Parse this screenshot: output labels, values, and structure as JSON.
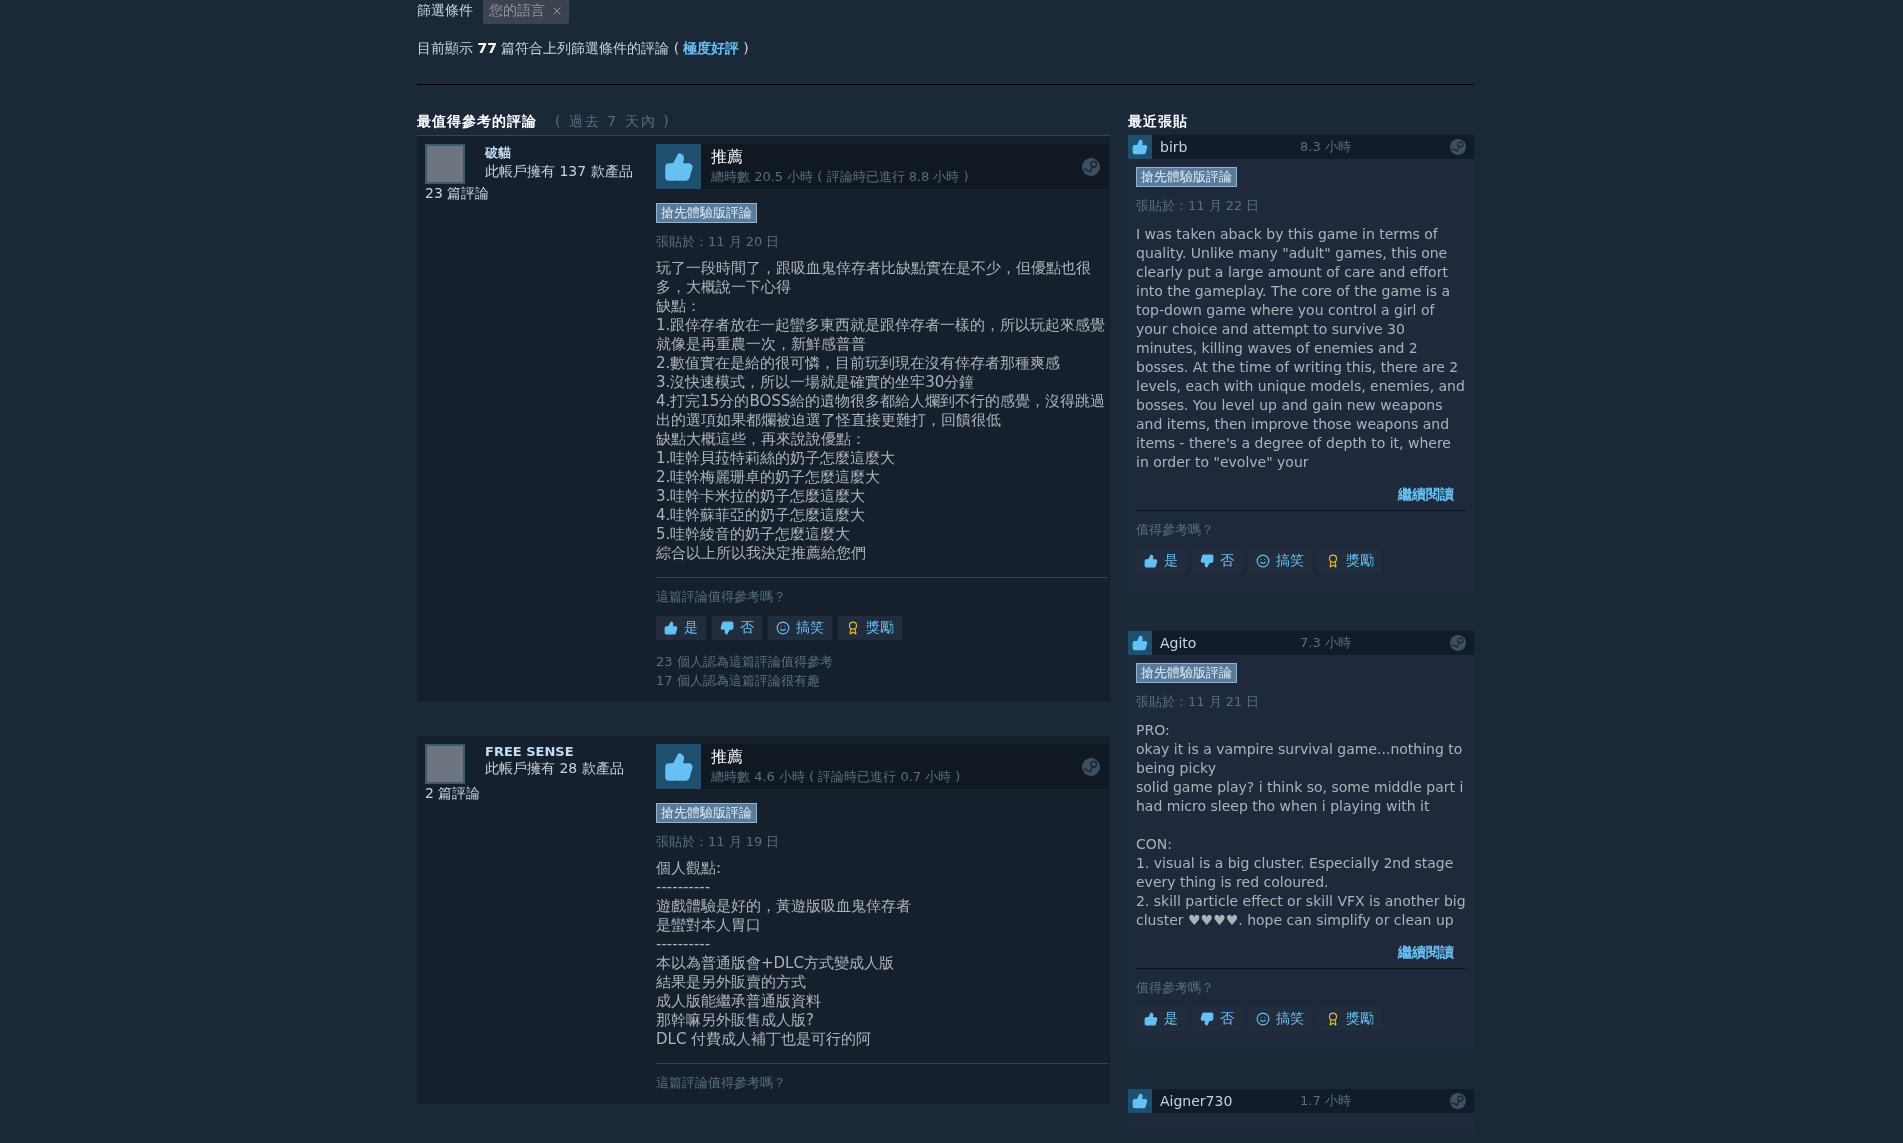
{
  "filter": {
    "label": "篩選條件",
    "tags": [
      {
        "label": "您的語言"
      }
    ]
  },
  "summary": {
    "text": "目前顯示 **77** 篇符合上列篩選條件的評論 (",
    "link": "極度好評",
    "end": ")"
  },
  "helpful": {
    "title": "最值得參考的評論",
    "period": "( 過去 7 天內 )",
    "reviews": [
      {
        "author": "破貓",
        "products": "此帳戶擁有 137 款產品",
        "review_count": "23 篇評論",
        "verdict": "推薦",
        "recommended": true,
        "hours": "總時數 20.5 小時 ( 評論時已進行 8.8 小時 )",
        "tag": "搶先體驗版評論",
        "posted": "張貼於：11 月 20 日",
        "body": [
          "玩了一段時間了，跟吸血鬼倖存者比缺點實在是不少，但優點也很多，大概說一下心得",
          "缺點：",
          "1.跟倖存者放在一起蠻多東西就是跟倖存者一樣的，所以玩起來感覺就像是再重農一次，新鮮感普普",
          "2.數值實在是給的很可憐，目前玩到現在沒有倖存者那種爽感",
          "3.沒快速模式，所以一場就是確實的坐牢30分鐘",
          "4.打完15分的BOSS給的遺物很多都給人爛到不行的感覺，沒得跳過出的選項如果都爛被迫選了怪直接更難打，回饋很低",
          "缺點大概這些，再來說說優點：",
          "1.哇幹貝菈特莉絲的奶子怎麼這麼大",
          "2.哇幹梅麗珊卓的奶子怎麼這麼大",
          "3.哇幹卡米拉的奶子怎麼這麼大",
          "4.哇幹蘇菲亞的奶子怎麼這麼大",
          "5.哇幹綾音的奶子怎麼這麼大",
          "綜合以上所以我決定推薦給您們"
        ],
        "question": "這篇評論值得參考嗎？",
        "buttons": [
          {
            "label": "是",
            "kind": "yes"
          },
          {
            "label": "否",
            "kind": "no"
          },
          {
            "label": "搞笑",
            "kind": "funny"
          },
          {
            "label": "獎勵",
            "kind": "award"
          }
        ],
        "counts": [
          "23 個人認為這篇評論值得參考",
          "17 個人認為這篇評論很有趣"
        ]
      },
      {
        "author": "FREE SENSE",
        "products": "此帳戶擁有 28 款產品",
        "review_count": "2 篇評論",
        "verdict": "推薦",
        "recommended": true,
        "hours": "總時數 4.6 小時 ( 評論時已進行 0.7 小時 )",
        "tag": "搶先體驗版評論",
        "posted": "張貼於：11 月 19 日",
        "body": [
          "個人觀點:",
          "----------",
          "遊戲體驗是好的，黃遊版吸血鬼倖存者",
          "是蠻對本人胃口",
          "----------",
          "本以為普通版會+DLC方式變成人版",
          "結果是另外販賣的方式",
          "成人版能繼承普通版資料",
          "那幹嘛另外販售成人版?",
          "DLC 付費成人補丁也是可行的阿"
        ],
        "question": "這篇評論值得參考嗎？"
      }
    ]
  },
  "recent": {
    "title": "最近張貼",
    "reviews": [
      {
        "author": "birb",
        "recommended": true,
        "hours": "8.3 小時",
        "tag": "搶先體驗版評論",
        "posted": "張貼於：11 月 22 日",
        "body": [
          "I was taken aback by this game in terms of quality. Unlike many \"adult\" games, this one clearly put a large amount of care and effort into the gameplay. The core of the game is a top-down game where you control a girl of your choice and attempt to survive 30 minutes, killing waves of enemies and 2 bosses. At the time of writing this, there are 2 levels, each with unique models, enemies, and bosses. You level up and gain new weapons and items, then improve those weapons and items - there's a degree of depth to it, where in order to \"evolve\" your"
        ],
        "read_more": "繼續閱讀",
        "question": "值得參考嗎？",
        "buttons": [
          {
            "label": "是",
            "kind": "yes"
          },
          {
            "label": "否",
            "kind": "no"
          },
          {
            "label": "搞笑",
            "kind": "funny"
          },
          {
            "label": "獎勵",
            "kind": "award"
          }
        ]
      },
      {
        "author": "Agito",
        "recommended": true,
        "hours": "7.3 小時",
        "tag": "搶先體驗版評論",
        "posted": "張貼於：11 月 21 日",
        "body": [
          "PRO:",
          "okay it is a vampire survival game...nothing to being picky",
          "solid game play? i think so, some middle part i had micro sleep tho when i playing with it"
        ],
        "body_after_gap": [
          "CON:",
          "1. visual is a big cluster. Especially 2nd stage every thing is red coloured.",
          "2. skill particle effect or skill VFX is another big cluster ♥♥♥♥. hope can simplify or clean up"
        ],
        "read_more": "繼續閱讀",
        "question": "值得參考嗎？",
        "buttons": [
          {
            "label": "是",
            "kind": "yes"
          },
          {
            "label": "否",
            "kind": "no"
          },
          {
            "label": "搞笑",
            "kind": "funny"
          },
          {
            "label": "獎勵",
            "kind": "award"
          }
        ]
      },
      {
        "author": "Aigner730",
        "recommended": true,
        "hours": "1.7 小時"
      }
    ]
  }
}
